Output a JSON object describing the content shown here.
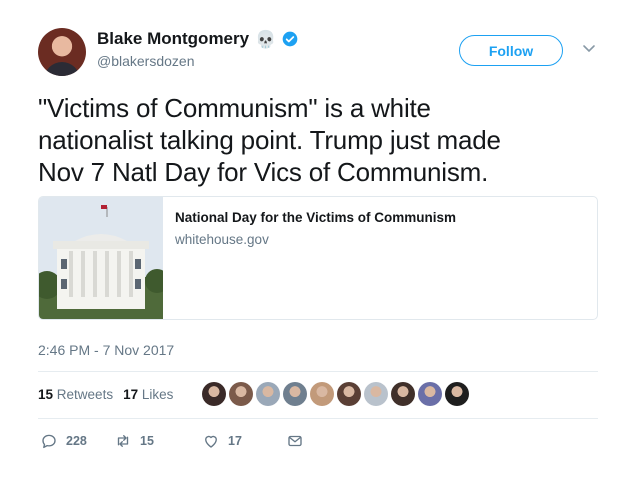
{
  "author": {
    "name": "Blake Montgomery",
    "handle": "@blakersdozen",
    "emoji": "💀",
    "verified": true
  },
  "follow_button": {
    "label": "Follow"
  },
  "tweet": {
    "lines": [
      "\"Victims of Communism\" is a white",
      "nationalist talking point. Trump just made",
      "Nov 7 Natl Day for Vics of Communism."
    ]
  },
  "card": {
    "title": "National Day for the Victims of Communism",
    "domain": "whitehouse.gov"
  },
  "timestamp": "2:46 PM - 7 Nov 2017",
  "stats": {
    "retweets_count": "15",
    "retweets_label": "Retweets",
    "likes_count": "17",
    "likes_label": "Likes"
  },
  "likers": [
    "#3a2a28",
    "#7b5a4a",
    "#9aa8b8",
    "#6f7f8f",
    "#c29a7a",
    "#5a3f35",
    "#b9c2cc",
    "#40302a",
    "#6a6fa8",
    "#1e1e1e"
  ],
  "actions": {
    "reply_count": "228",
    "retweet_count": "15",
    "like_count": "17"
  },
  "colors": {
    "accent": "#1da1f2",
    "muted": "#657786",
    "text": "#14171a"
  }
}
